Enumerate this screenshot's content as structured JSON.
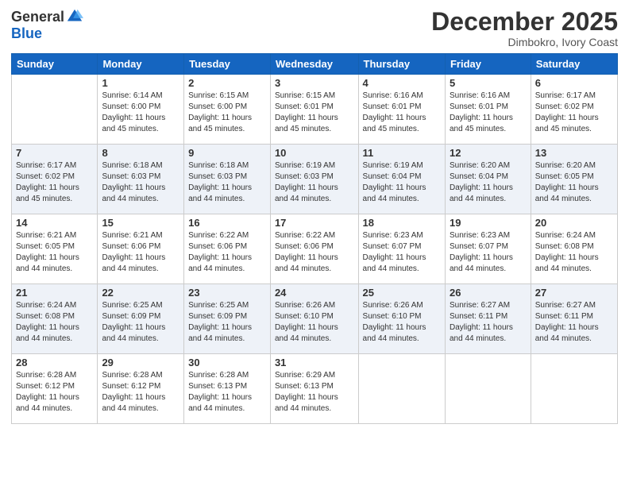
{
  "logo": {
    "general": "General",
    "blue": "Blue"
  },
  "title": "December 2025",
  "subtitle": "Dimbokro, Ivory Coast",
  "days_of_week": [
    "Sunday",
    "Monday",
    "Tuesday",
    "Wednesday",
    "Thursday",
    "Friday",
    "Saturday"
  ],
  "weeks": [
    [
      {
        "day": "",
        "info": ""
      },
      {
        "day": "1",
        "info": "Sunrise: 6:14 AM\nSunset: 6:00 PM\nDaylight: 11 hours\nand 45 minutes."
      },
      {
        "day": "2",
        "info": "Sunrise: 6:15 AM\nSunset: 6:00 PM\nDaylight: 11 hours\nand 45 minutes."
      },
      {
        "day": "3",
        "info": "Sunrise: 6:15 AM\nSunset: 6:01 PM\nDaylight: 11 hours\nand 45 minutes."
      },
      {
        "day": "4",
        "info": "Sunrise: 6:16 AM\nSunset: 6:01 PM\nDaylight: 11 hours\nand 45 minutes."
      },
      {
        "day": "5",
        "info": "Sunrise: 6:16 AM\nSunset: 6:01 PM\nDaylight: 11 hours\nand 45 minutes."
      },
      {
        "day": "6",
        "info": "Sunrise: 6:17 AM\nSunset: 6:02 PM\nDaylight: 11 hours\nand 45 minutes."
      }
    ],
    [
      {
        "day": "7",
        "info": "Sunrise: 6:17 AM\nSunset: 6:02 PM\nDaylight: 11 hours\nand 45 minutes."
      },
      {
        "day": "8",
        "info": "Sunrise: 6:18 AM\nSunset: 6:03 PM\nDaylight: 11 hours\nand 44 minutes."
      },
      {
        "day": "9",
        "info": "Sunrise: 6:18 AM\nSunset: 6:03 PM\nDaylight: 11 hours\nand 44 minutes."
      },
      {
        "day": "10",
        "info": "Sunrise: 6:19 AM\nSunset: 6:03 PM\nDaylight: 11 hours\nand 44 minutes."
      },
      {
        "day": "11",
        "info": "Sunrise: 6:19 AM\nSunset: 6:04 PM\nDaylight: 11 hours\nand 44 minutes."
      },
      {
        "day": "12",
        "info": "Sunrise: 6:20 AM\nSunset: 6:04 PM\nDaylight: 11 hours\nand 44 minutes."
      },
      {
        "day": "13",
        "info": "Sunrise: 6:20 AM\nSunset: 6:05 PM\nDaylight: 11 hours\nand 44 minutes."
      }
    ],
    [
      {
        "day": "14",
        "info": "Sunrise: 6:21 AM\nSunset: 6:05 PM\nDaylight: 11 hours\nand 44 minutes."
      },
      {
        "day": "15",
        "info": "Sunrise: 6:21 AM\nSunset: 6:06 PM\nDaylight: 11 hours\nand 44 minutes."
      },
      {
        "day": "16",
        "info": "Sunrise: 6:22 AM\nSunset: 6:06 PM\nDaylight: 11 hours\nand 44 minutes."
      },
      {
        "day": "17",
        "info": "Sunrise: 6:22 AM\nSunset: 6:06 PM\nDaylight: 11 hours\nand 44 minutes."
      },
      {
        "day": "18",
        "info": "Sunrise: 6:23 AM\nSunset: 6:07 PM\nDaylight: 11 hours\nand 44 minutes."
      },
      {
        "day": "19",
        "info": "Sunrise: 6:23 AM\nSunset: 6:07 PM\nDaylight: 11 hours\nand 44 minutes."
      },
      {
        "day": "20",
        "info": "Sunrise: 6:24 AM\nSunset: 6:08 PM\nDaylight: 11 hours\nand 44 minutes."
      }
    ],
    [
      {
        "day": "21",
        "info": "Sunrise: 6:24 AM\nSunset: 6:08 PM\nDaylight: 11 hours\nand 44 minutes."
      },
      {
        "day": "22",
        "info": "Sunrise: 6:25 AM\nSunset: 6:09 PM\nDaylight: 11 hours\nand 44 minutes."
      },
      {
        "day": "23",
        "info": "Sunrise: 6:25 AM\nSunset: 6:09 PM\nDaylight: 11 hours\nand 44 minutes."
      },
      {
        "day": "24",
        "info": "Sunrise: 6:26 AM\nSunset: 6:10 PM\nDaylight: 11 hours\nand 44 minutes."
      },
      {
        "day": "25",
        "info": "Sunrise: 6:26 AM\nSunset: 6:10 PM\nDaylight: 11 hours\nand 44 minutes."
      },
      {
        "day": "26",
        "info": "Sunrise: 6:27 AM\nSunset: 6:11 PM\nDaylight: 11 hours\nand 44 minutes."
      },
      {
        "day": "27",
        "info": "Sunrise: 6:27 AM\nSunset: 6:11 PM\nDaylight: 11 hours\nand 44 minutes."
      }
    ],
    [
      {
        "day": "28",
        "info": "Sunrise: 6:28 AM\nSunset: 6:12 PM\nDaylight: 11 hours\nand 44 minutes."
      },
      {
        "day": "29",
        "info": "Sunrise: 6:28 AM\nSunset: 6:12 PM\nDaylight: 11 hours\nand 44 minutes."
      },
      {
        "day": "30",
        "info": "Sunrise: 6:28 AM\nSunset: 6:13 PM\nDaylight: 11 hours\nand 44 minutes."
      },
      {
        "day": "31",
        "info": "Sunrise: 6:29 AM\nSunset: 6:13 PM\nDaylight: 11 hours\nand 44 minutes."
      },
      {
        "day": "",
        "info": ""
      },
      {
        "day": "",
        "info": ""
      },
      {
        "day": "",
        "info": ""
      }
    ]
  ]
}
